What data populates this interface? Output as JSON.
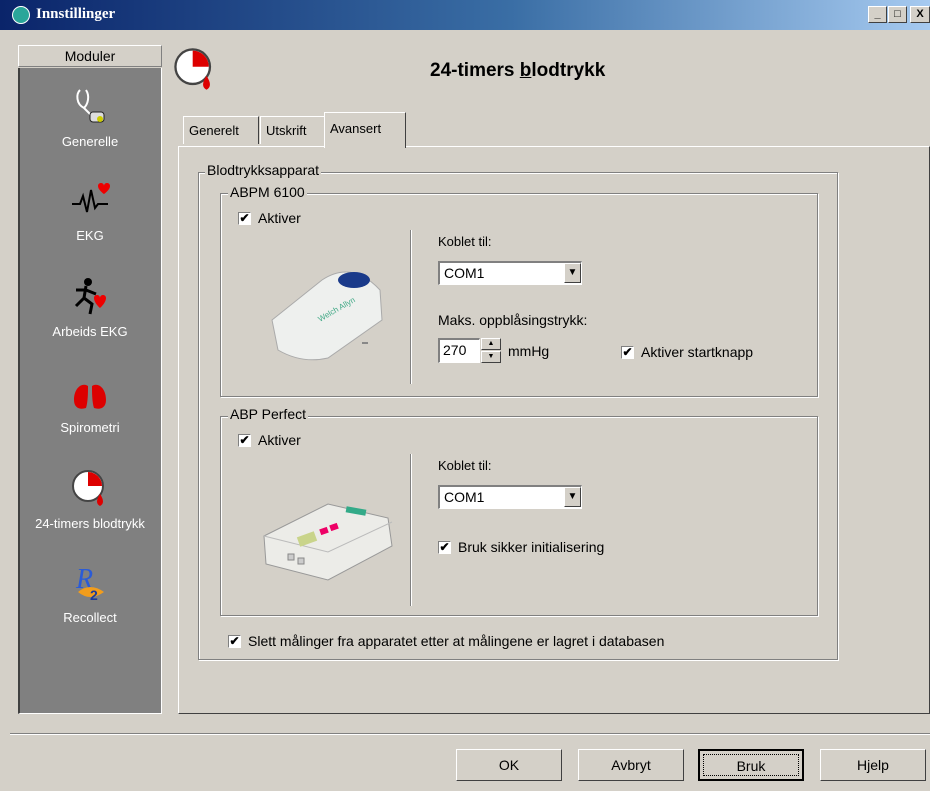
{
  "window": {
    "title": "Innstillinger",
    "controls": [
      "_",
      "□",
      "X"
    ]
  },
  "sidebar": {
    "header": "Moduler",
    "items": [
      {
        "label": "Generelle",
        "icon": "stethoscope-icon"
      },
      {
        "label": "EKG",
        "icon": "heartbeat-icon"
      },
      {
        "label": "Arbeids EKG",
        "icon": "running-heart-icon"
      },
      {
        "label": "Spirometri",
        "icon": "lungs-icon"
      },
      {
        "label": "24-timers blodtrykk",
        "icon": "clock-drop-icon"
      },
      {
        "label": "Recollect",
        "icon": "recollect-logo-icon"
      }
    ]
  },
  "header": {
    "title_pre": "24-timers ",
    "title_u": "b",
    "title_post": "lodtrykk",
    "icon": "clock-drop-icon"
  },
  "tabs": [
    {
      "label": "Generelt",
      "active": false
    },
    {
      "label": "Utskrift",
      "active": false
    },
    {
      "label": "Avansert",
      "active": true
    }
  ],
  "blodtrykk": {
    "group_label": "Blodtrykksapparat",
    "abpm": {
      "label": "ABPM 6100",
      "activate_label": "Aktiver",
      "activate_checked": true,
      "connected_label": "Koblet til:",
      "port": "COM1",
      "max_pressure_label": "Maks. oppblåsingstrykk:",
      "max_pressure_value": "270",
      "unit": "mmHg",
      "startbutton_label": "Aktiver startknapp",
      "startbutton_checked": true
    },
    "abp_perfect": {
      "label": "ABP Perfect",
      "activate_label": "Aktiver",
      "activate_checked": true,
      "connected_label": "Koblet til:",
      "port": "COM1",
      "safe_init_label": "Bruk sikker initialisering",
      "safe_init_checked": true
    },
    "delete_label": "Slett målinger fra apparatet etter at målingene er lagret i databasen",
    "delete_checked": true
  },
  "buttons": {
    "ok": "OK",
    "cancel": "Avbryt",
    "apply": "Bruk",
    "help": "Hjelp"
  },
  "check_mark": "✔"
}
